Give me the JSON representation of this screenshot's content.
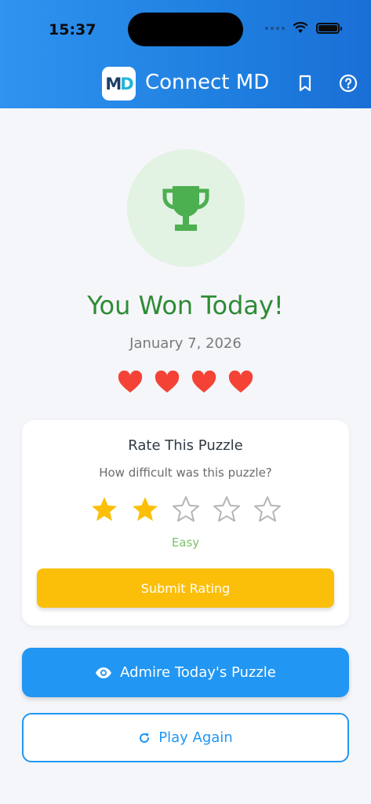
{
  "status_bar": {
    "time": "15:37"
  },
  "header": {
    "logo_m": "M",
    "logo_d": "D",
    "title": "Connect MD",
    "icons": [
      "bookmark-icon",
      "help-icon"
    ]
  },
  "result": {
    "title": "You Won Today!",
    "date": "January 7, 2026",
    "hearts_remaining": 4,
    "hearts_total": 4
  },
  "rating_card": {
    "title": "Rate This Puzzle",
    "question": "How difficult was this puzzle?",
    "rating": 2,
    "max_rating": 5,
    "difficulty_label": "Easy",
    "submit_label": "Submit Rating"
  },
  "actions": {
    "admire_label": "Admire Today's Puzzle",
    "play_again_label": "Play Again"
  },
  "colors": {
    "header_gradient_start": "#2f93ef",
    "header_gradient_end": "#1a6fd6",
    "win_green": "#2e8b34",
    "trophy_green": "#4caf50",
    "heart_red": "#f44336",
    "star_gold": "#fbbf0a",
    "primary_blue": "#2196f3"
  }
}
